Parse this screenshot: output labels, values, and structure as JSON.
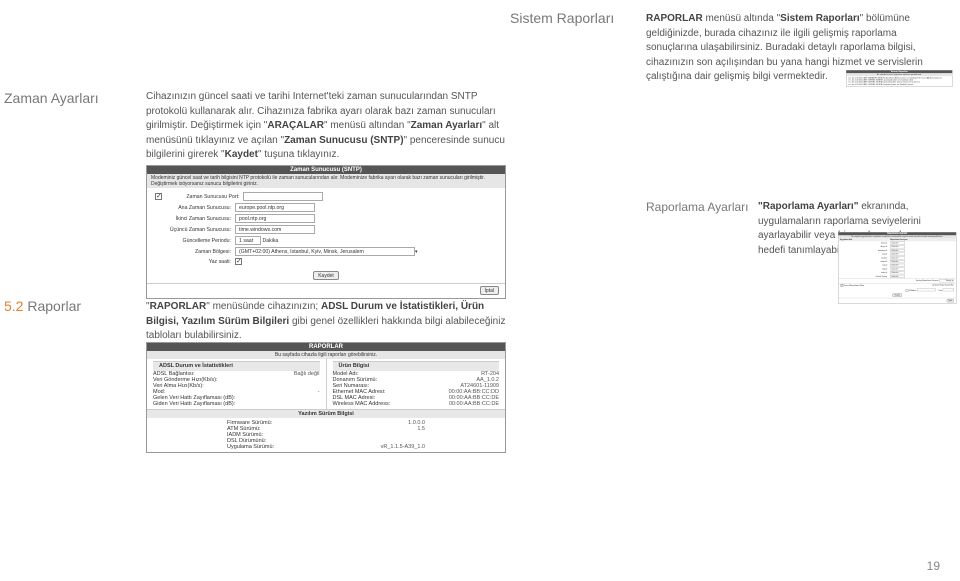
{
  "sistem": {
    "title": "Sistem Raporları",
    "text_pre": "RAPORLAR",
    "text_1": " menüsü altında \"",
    "text_bold2": "Sistem Raporları",
    "text_2": "\" bölümüne geldiğinizde, burada cihazınız ile ilgili gelişmiş raporlama sonuçlarına ulaşabilirsiniz. Buradaki detaylı raporlama bilgisi, cihazınızın son açılışından bu yana hangi hizmet ve servislerin çalıştığına dair gelişmiş bilgi vermektedir."
  },
  "zaman": {
    "title": "Zaman Ayarları",
    "p1": "Cihazınızın güncel saati ve tarihi Internet'teki zaman sunucularından SNTP protokolü kullanarak alır. Cihazınıza fabrika ayarı olarak bazı zaman sunucuları girilmiştir. Değiştirmek için \"",
    "b1": "ARAÇALAR",
    "p2": "\" menüsü altından \"",
    "b2": "Zaman Ayarları",
    "p3": "\" alt menüsünü tıklayınız ve açılan \"",
    "b3": "Zaman Sunucusu (SNTP)",
    "p4": "\" penceresinde sunucu bilgilerini girerek \"",
    "b4": "Kaydet",
    "p5": "\" tuşuna tıklayınız."
  },
  "sntp_panel": {
    "title": "Zaman Sunucusu (SNTP)",
    "desc": "Modeminiz güncel saat ve tarih bilgisini NTP protokolü ile zaman sunucularından alır. Modeminize fabrika ayarı olarak bazı zaman sunucuları girilmiştir. Değiştirmek istiyorsanız sunucu bilgilerini giriniz.",
    "row0_label": "Zaman Sunucusu Port:",
    "row0_value": "",
    "row1_label": "Ana Zaman Sunucusu:",
    "row1_value": "europe.pool.ntp.org",
    "row2_label": "İkinci Zaman Sunucusu:",
    "row2_value": "pool.ntp.org",
    "row3_label": "Üçüncü Zaman Sunucusu:",
    "row3_value": "time.windows.com",
    "row4_label": "Güncelleme Periodu:",
    "row4_value": "1 saat",
    "row5_label": "Zaman Bölgesi:",
    "row5_value": "(GMT+02:00) Athens, Istanbul, Kyiv, Minsk, Jerusalem",
    "row6_label": "Yaz saati:",
    "btn_kaydet": "Kaydet",
    "btn_iptal": "İptal",
    "dakika": "Dakika"
  },
  "syslog_panel": {
    "title": "Sistem Raporları",
    "sub": "Bu sayfada kernel ve uygulama raporlarını görebilirsiniz.",
    "lines": [
      ">>> Jan 1 02:00:13 ASP_MANAGER SENDRC [localhost: ADSLCounters Created/open file name=[ADSLCounters.txt",
      ">>> Jan 1 02:00:10 ASP_KERNEL WEBSEL [assistant] xdmt: init_module() called",
      ">>> Jan 1 02:00:10 ASP_KERNEL MORIAL [assistant] xdmt: device timeout set to 30 secs",
      ">>> Jan 1 02:00:10 ASP_KERNEL MORIAL [assistant] xdmt: Init_Module() returns"
    ]
  },
  "raporlama": {
    "title": "Raporlama Ayarları",
    "text_b": "\"Raporlama Ayarları\"",
    "text": " ekranında, uygulamaların raporlama seviyelerini ayarlayabilir veya bir uzak raporlama hedefi tanımlayabilirsiniz"
  },
  "rapor_panel": {
    "title": "Raporlama Ayarları",
    "sub": "Bu sayfada uygulamaların raporlama seviyelerini ayarlayabilir veya bir uzak raporlama hedefi tanımlayabilirsiniz.",
    "col1": "Uygulama Adı",
    "col2": "Raporlama Seviyesi",
    "rows": [
      {
        "name": "telnet-0",
        "level": "Critical"
      },
      {
        "name": "dhcps-0",
        "level": "Critical"
      },
      {
        "name": "dnaproxy-0",
        "level": "Critical"
      },
      {
        "name": "napt-0",
        "level": "Critical"
      },
      {
        "name": "noobist",
        "level": "Critical"
      },
      {
        "name": "routed-0",
        "level": "Critical"
      },
      {
        "name": "snip-0",
        "level": "Critical"
      },
      {
        "name": "voip-0",
        "level": "Critical"
      },
      {
        "name": "webs-0",
        "level": "Critical"
      }
    ],
    "kernel_label": "Kernel Syslog",
    "kernel_val": "Critical",
    "timing_label": "Syslog Raporlama Zamanı",
    "timing_val": "Timing",
    "enable_label": "Kernel Raporlama Etkin",
    "remote_label": "Uzaktan Raporlama Etkin",
    "ip_label": "IP Adresi",
    "port_label": "Port",
    "sel_suffix": "▾",
    "btn_kaydet": "Kaydet",
    "btn_iptal": "İptal"
  },
  "raporlar": {
    "num": "5.2 ",
    "title": "Raporlar",
    "t_pre": "\"",
    "t_b1": "RAPORLAR",
    "t_1": "\" menüsünde cihazınızın; ",
    "t_b2": "ADSL Durum ve İstatistikleri, Ürün Bilgisi, Yazılım Sürüm Bilgileri",
    "t_2": " gibi genel özellikleri hakkında bilgi alabileceğiniz tabloları bulabilirsiniz."
  },
  "raporlar_panel": {
    "title": "RAPORLAR",
    "sub": "Bu sayfada cihazla ilgili raporları görebilirsiniz.",
    "adsl_h": "ADSL Durum ve İstatistikleri",
    "urun_h": "Ürün Bilgisi",
    "adsl": [
      {
        "k": "ADSL Bağlantısı:",
        "v": "Bağlı değil"
      },
      {
        "k": "Veri Gönderme Hızı(Kb/s):",
        "v": ""
      },
      {
        "k": "Veri Alma Hızı(Kb/s):",
        "v": ""
      },
      {
        "k": "Mod:",
        "v": "-"
      },
      {
        "k": "Gelen Veri Hattı Zayıflaması (dB):",
        "v": ""
      },
      {
        "k": "Giden Veri Hattı Zayıflaması (dB):",
        "v": ""
      }
    ],
    "urun": [
      {
        "k": "Model Adı:",
        "v": "RT-204"
      },
      {
        "k": "Donanım Sürümü:",
        "v": "AA_1.0.2"
      },
      {
        "k": "Seri Numarası:",
        "v": "AT24601-11909"
      },
      {
        "k": "Ethernet MAC Adresi:",
        "v": "00:00:AA:BB:CC:DD"
      },
      {
        "k": "DSL MAC Adresi:",
        "v": "00:00:AA:BB:CC:DE"
      },
      {
        "k": "Wireless MAC Address:",
        "v": "00:00:AA:BB:CC:DE"
      }
    ],
    "yaz_h": "Yazılım Sürüm Bilgisi",
    "yaz": [
      {
        "k": "Firmware Sürümü:",
        "v": "1.0.0.0"
      },
      {
        "k": "ATM Sürümü:",
        "v": "1.5"
      },
      {
        "k": "IADM Sürümü:",
        "v": ""
      },
      {
        "k": "DSL Dürümünü:",
        "v": ""
      },
      {
        "k": "Uygulama Sürümü:",
        "v": "vR_1.1.5-A39_1.0"
      }
    ]
  },
  "pagenum": "19"
}
